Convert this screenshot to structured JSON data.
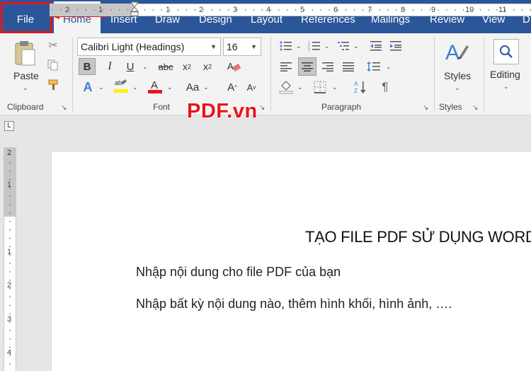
{
  "tabs": [
    "File",
    "Home",
    "Insert",
    "Draw",
    "Design",
    "Layout",
    "References",
    "Mailings",
    "Review",
    "View"
  ],
  "ribbon": {
    "clipboard": {
      "paste_label": "Paste",
      "group_label": "Clipboard"
    },
    "font": {
      "font_name": "Calibri Light (Headings)",
      "font_size": "16",
      "group_label": "Font"
    },
    "paragraph": {
      "group_label": "Paragraph"
    },
    "styles": {
      "label": "Styles",
      "group_label": "Styles"
    },
    "editing": {
      "label": "Editing"
    }
  },
  "ruler": {
    "horizontal_numbers": [
      "2",
      "1",
      "1",
      "2",
      "3",
      "4",
      "5",
      "6",
      "7",
      "8",
      "9",
      "10",
      "11"
    ],
    "vertical_numbers": [
      "2",
      "1",
      "1",
      "2",
      "3",
      "4"
    ]
  },
  "document": {
    "title": "TẠO FILE PDF SỬ DỤNG WORD",
    "paragraphs": [
      "Nhập nội dung cho file PDF của bạn",
      "Nhập bất kỳ nội dung nào, thêm hình khối, hình ảnh, …."
    ]
  },
  "watermark": "PDF.vn",
  "colors": {
    "ribbon_blue": "#2b579a",
    "highlight_red": "#e8151b"
  }
}
